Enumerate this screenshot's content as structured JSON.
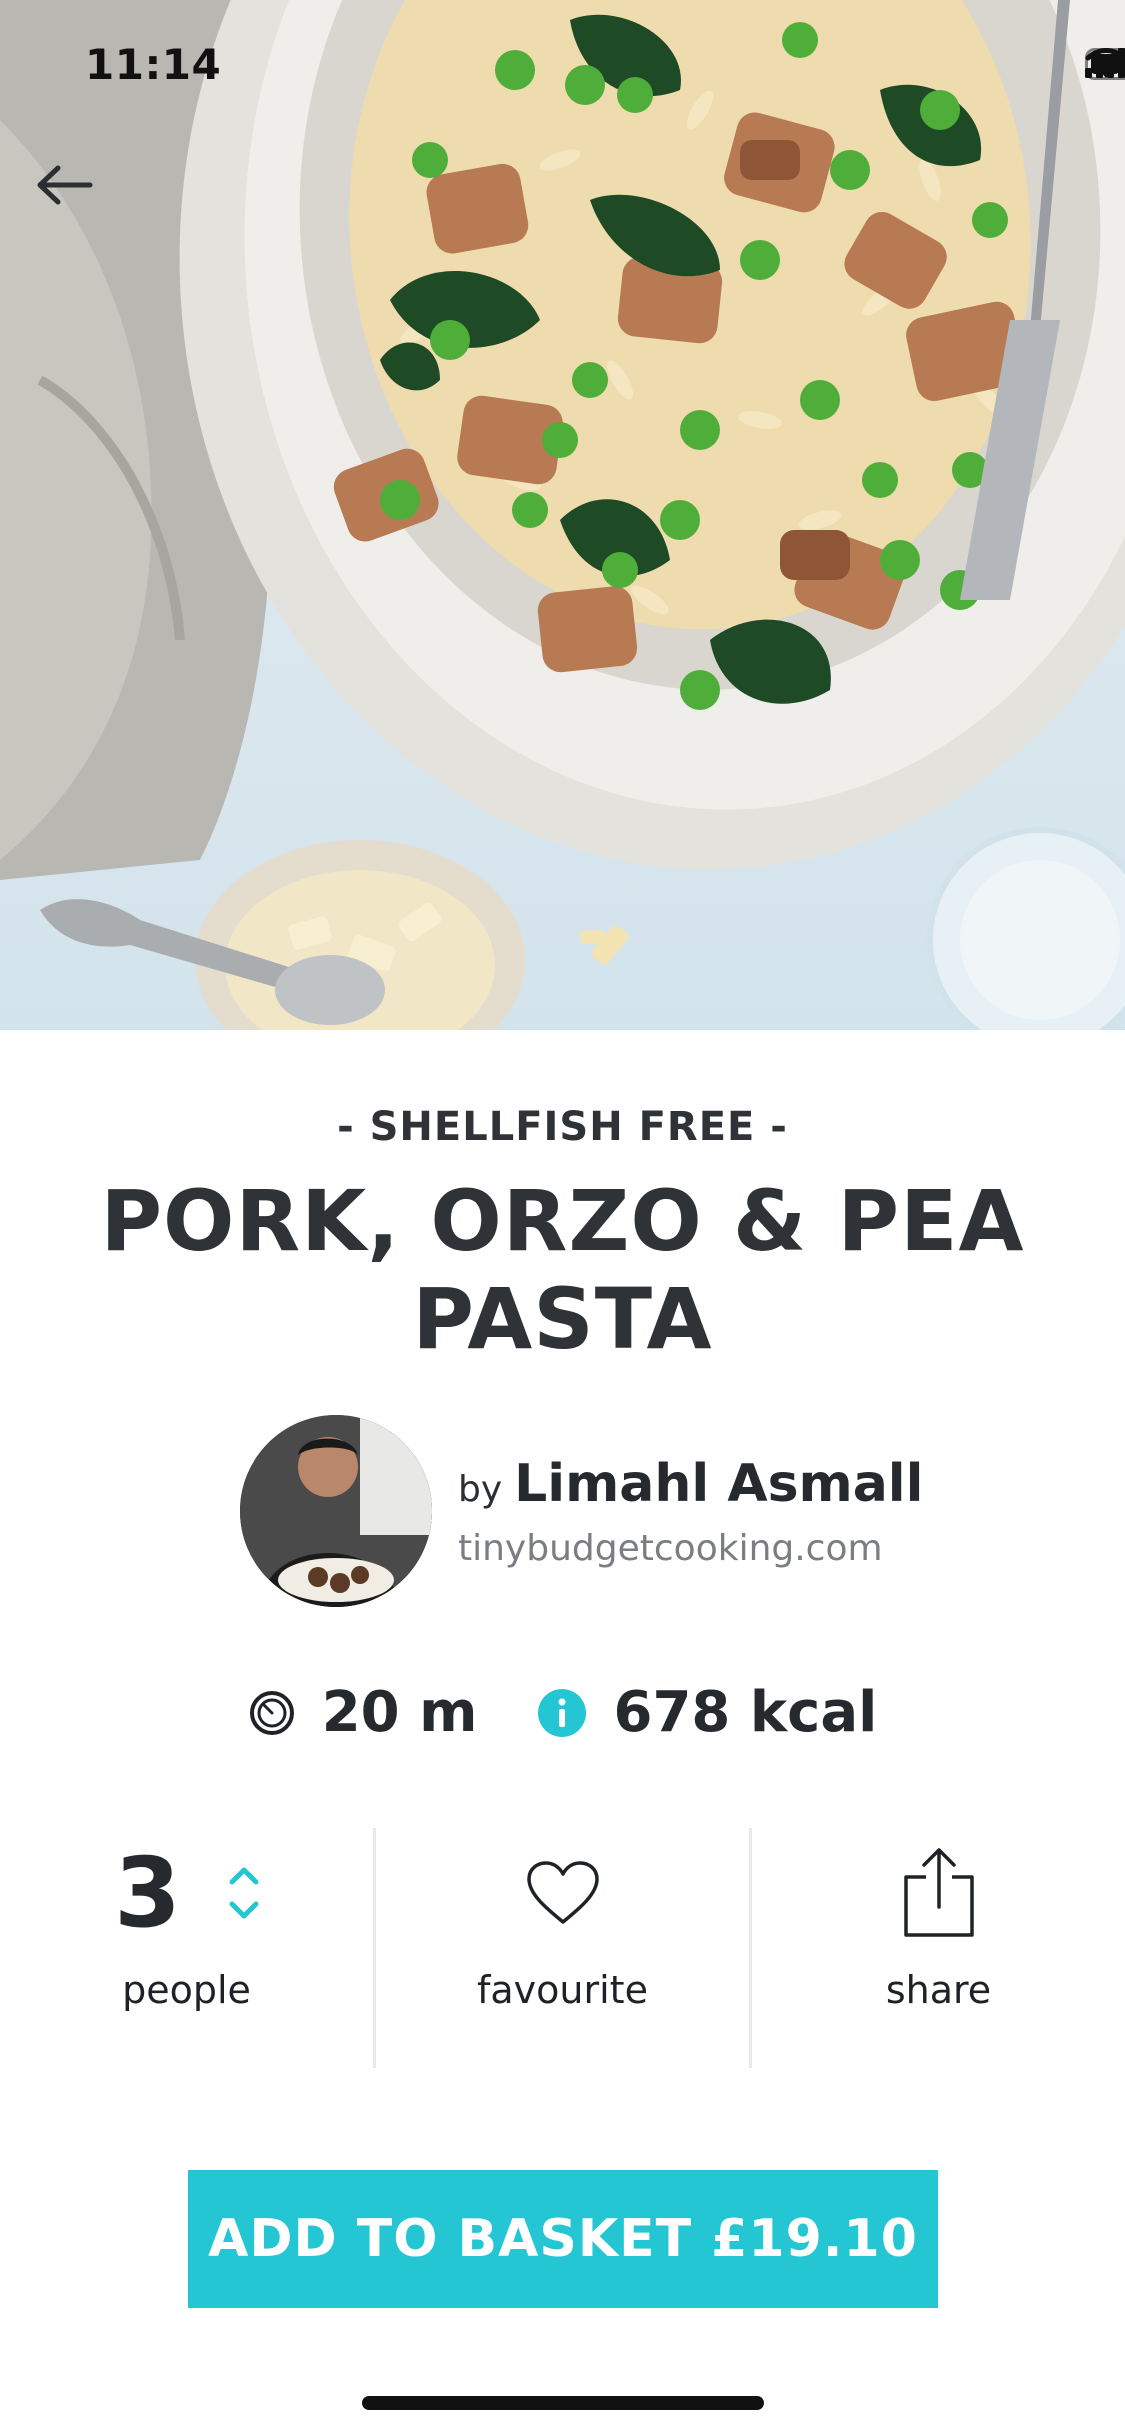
{
  "status_bar": {
    "time": "11:14"
  },
  "nav": {
    "back_icon": "arrow-left-icon"
  },
  "recipe": {
    "subtitle": "- SHELLFISH FREE -",
    "title": "PORK, ORZO & PEA PASTA",
    "hero_alt": "Bowl of pork, orzo and pea pasta"
  },
  "author": {
    "by": "by",
    "name": "Limahl Asmall",
    "site": "tinybudgetcooking.com"
  },
  "stats": {
    "time_icon": "timer-icon",
    "time": "20 m",
    "info_icon": "info-icon",
    "calories": "678 kcal"
  },
  "actions": {
    "people_count": "3",
    "people_label": "people",
    "favourite_label": "favourite",
    "share_label": "share"
  },
  "basket": {
    "label": "ADD TO BASKET £19.10"
  },
  "colors": {
    "accent": "#25c6d4",
    "text": "#2f3337"
  }
}
